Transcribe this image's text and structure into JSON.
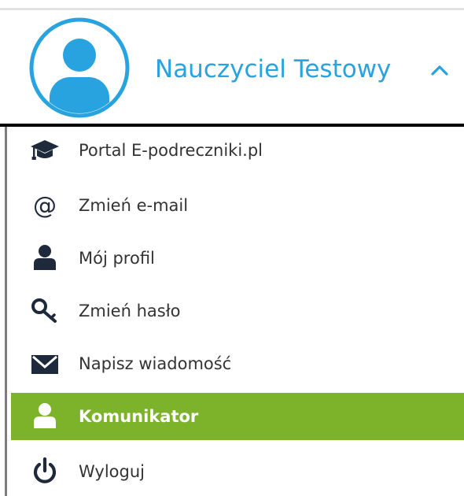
{
  "colors": {
    "accent": "#29a3e0",
    "avatar_ring": "#29a3e0",
    "icon_dark": "#1e2a3c",
    "text": "#333333",
    "active_bg": "#7cb32a",
    "active_text": "#ffffff"
  },
  "user": {
    "name": "Nauczyciel Testowy",
    "avatar_icon": "user-avatar-icon",
    "caret_icon": "chevron-up-icon"
  },
  "menu": {
    "items": [
      {
        "label": "Portal E-podreczniki.pl",
        "icon": "graduation-cap-icon",
        "active": false
      },
      {
        "label": "Zmień e-mail",
        "icon": "at-sign-icon",
        "active": false
      },
      {
        "label": "Mój profil",
        "icon": "user-icon",
        "active": false
      },
      {
        "label": "Zmień hasło",
        "icon": "key-icon",
        "active": false
      },
      {
        "label": "Napisz wiadomość",
        "icon": "envelope-icon",
        "active": false
      },
      {
        "label": "Komunikator",
        "icon": "user-icon",
        "active": true
      },
      {
        "label": "Wyloguj",
        "icon": "power-icon",
        "active": false
      }
    ]
  }
}
